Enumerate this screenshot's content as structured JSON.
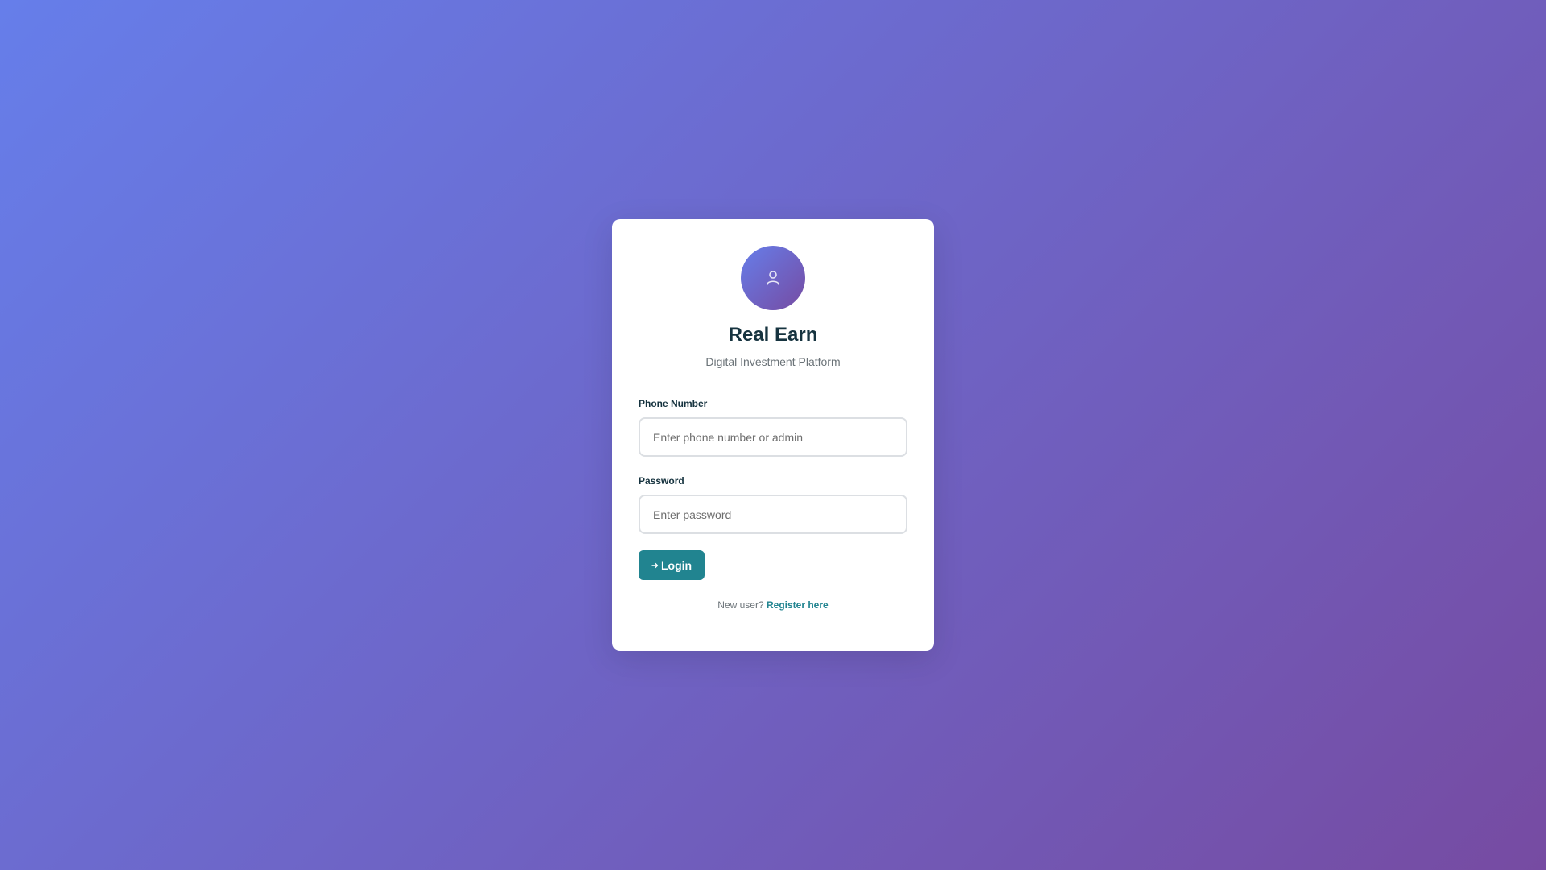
{
  "brand": {
    "title": "Real Earn",
    "subtitle": "Digital Investment Platform",
    "logo_icon": "user-icon"
  },
  "form": {
    "phone": {
      "label": "Phone Number",
      "placeholder": "Enter phone number or admin",
      "value": ""
    },
    "password": {
      "label": "Password",
      "placeholder": "Enter password",
      "value": ""
    },
    "login_button": {
      "label": "Login",
      "icon": "sign-in-icon"
    }
  },
  "footer": {
    "prompt": "New user?",
    "register_link": "Register here"
  },
  "colors": {
    "background_gradient_start": "#667eea",
    "background_gradient_end": "#764ba2",
    "accent": "#218490",
    "title": "#16333f"
  }
}
